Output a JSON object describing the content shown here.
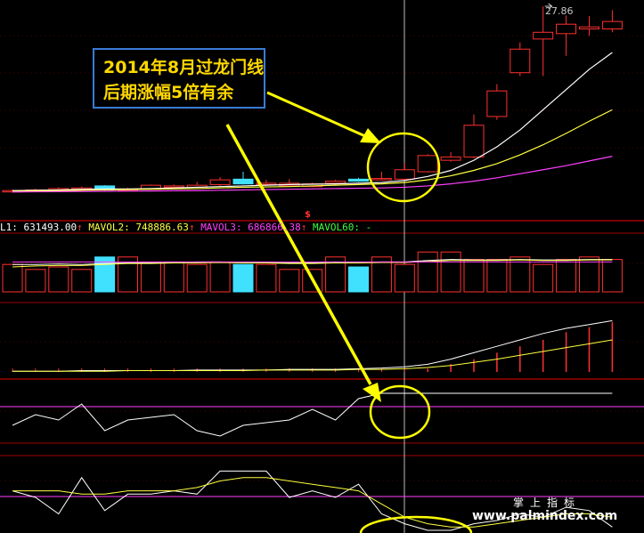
{
  "annotation": {
    "line1": "2014年8月过龙门线",
    "line2": "后期涨幅5倍有余"
  },
  "price_label": "27.86",
  "signal_mark": "$",
  "volume_legend": {
    "item1": "L1: 631493.00",
    "item2": "MAVOL2: 748886.63",
    "item3": "MAVOL3: 686866.38",
    "item4": "MAVOL60: -"
  },
  "watermark": {
    "cn": "掌上指标",
    "url": "www.palmindex.com"
  },
  "colors": {
    "background": "#000000",
    "up": "#ff3030",
    "down": "#40e0ff",
    "ma_white": "#ffffff",
    "ma_yellow": "#ffff40",
    "ma_magenta": "#ff40ff",
    "annotation_border": "#3a7bd5",
    "highlight": "#ffff00",
    "grid": "#a00000"
  },
  "chart_data": [
    {
      "type": "candlestick",
      "title": "",
      "candles": [
        {
          "o": 0.3,
          "c": 0.5,
          "h": 0.7,
          "l": 0.2
        },
        {
          "o": 0.4,
          "c": 0.6,
          "h": 0.8,
          "l": 0.3
        },
        {
          "o": 0.5,
          "c": 0.8,
          "h": 1.0,
          "l": 0.4
        },
        {
          "o": 0.8,
          "c": 0.9,
          "h": 1.1,
          "l": 0.7
        },
        {
          "o": 1.2,
          "c": 0.6,
          "h": 1.3,
          "l": 0.5
        },
        {
          "o": 0.6,
          "c": 0.7,
          "h": 0.9,
          "l": 0.5
        },
        {
          "o": 0.7,
          "c": 1.3,
          "h": 1.4,
          "l": 0.6
        },
        {
          "o": 1.0,
          "c": 1.2,
          "h": 1.4,
          "l": 0.9
        },
        {
          "o": 1.0,
          "c": 1.3,
          "h": 1.8,
          "l": 0.9
        },
        {
          "o": 1.4,
          "c": 2.1,
          "h": 2.5,
          "l": 1.2
        },
        {
          "o": 2.2,
          "c": 1.5,
          "h": 3.3,
          "l": 1.4
        },
        {
          "o": 1.5,
          "c": 1.6,
          "h": 2.1,
          "l": 1.3
        },
        {
          "o": 1.2,
          "c": 1.6,
          "h": 2.2,
          "l": 1.1
        },
        {
          "o": 1.1,
          "c": 1.5,
          "h": 1.7,
          "l": 1.0
        },
        {
          "o": 1.6,
          "c": 1.9,
          "h": 2.1,
          "l": 1.4
        },
        {
          "o": 2.2,
          "c": 1.9,
          "h": 2.4,
          "l": 1.8
        },
        {
          "o": 2.2,
          "c": 2.3,
          "h": 3.3,
          "l": 2.0
        },
        {
          "o": 2.2,
          "c": 3.6,
          "h": 4.6,
          "l": 2.0
        },
        {
          "o": 3.3,
          "c": 5.7,
          "h": 5.9,
          "l": 3.2
        },
        {
          "o": 5.0,
          "c": 5.5,
          "h": 6.2,
          "l": 4.8
        },
        {
          "o": 5.5,
          "c": 10.2,
          "h": 11.8,
          "l": 5.3
        },
        {
          "o": 11.5,
          "c": 15.3,
          "h": 16.3,
          "l": 11.0
        },
        {
          "o": 18.0,
          "c": 21.5,
          "h": 22.5,
          "l": 17.5
        },
        {
          "o": 23.0,
          "c": 24.0,
          "h": 27.86,
          "l": 17.5
        },
        {
          "o": 23.8,
          "c": 25.2,
          "h": 26.5,
          "l": 20.5
        },
        {
          "o": 24.5,
          "c": 24.8,
          "h": 26.4,
          "l": 23.5
        },
        {
          "o": 24.5,
          "c": 25.6,
          "h": 27.3,
          "l": 24.0
        }
      ],
      "down_candles": [
        4,
        10,
        15
      ],
      "series": [
        {
          "name": "",
          "color": "white",
          "values": [
            0.5,
            0.55,
            0.6,
            0.7,
            0.75,
            0.75,
            0.8,
            0.9,
            1.0,
            1.1,
            1.2,
            1.3,
            1.4,
            1.45,
            1.5,
            1.6,
            1.7,
            2.0,
            2.6,
            3.5,
            5.0,
            7.0,
            9.5,
            12.5,
            15.5,
            18.5,
            21.0
          ]
        },
        {
          "name": "",
          "color": "yellow",
          "values": [
            0.4,
            0.45,
            0.5,
            0.55,
            0.6,
            0.65,
            0.7,
            0.75,
            0.8,
            0.9,
            1.0,
            1.05,
            1.1,
            1.2,
            1.3,
            1.4,
            1.5,
            1.7,
            2.1,
            2.7,
            3.5,
            4.5,
            5.8,
            7.3,
            9.0,
            10.8,
            12.5
          ]
        },
        {
          "name": "",
          "color": "magenta",
          "values": [
            0.3,
            0.32,
            0.35,
            0.38,
            0.4,
            0.42,
            0.45,
            0.48,
            0.5,
            0.55,
            0.6,
            0.65,
            0.7,
            0.75,
            0.8,
            0.85,
            0.9,
            1.0,
            1.2,
            1.5,
            1.9,
            2.4,
            3.0,
            3.6,
            4.2,
            4.9,
            5.6
          ]
        }
      ],
      "ylim": [
        0,
        28
      ]
    },
    {
      "type": "bar",
      "title": "",
      "values": [
        0.55,
        0.45,
        0.5,
        0.45,
        0.7,
        0.7,
        0.6,
        0.6,
        0.55,
        0.6,
        0.55,
        0.55,
        0.45,
        0.45,
        0.7,
        0.5,
        0.7,
        0.55,
        0.8,
        0.8,
        0.65,
        0.65,
        0.7,
        0.55,
        0.65,
        0.7,
        0.65
      ],
      "down_bars": [
        4,
        10,
        15
      ],
      "series": [
        {
          "name": "L1",
          "color": "white",
          "values": [
            0.55,
            0.55,
            0.56,
            0.55,
            0.57,
            0.58,
            0.58,
            0.59,
            0.6,
            0.6,
            0.59,
            0.59,
            0.58,
            0.58,
            0.6,
            0.59,
            0.6,
            0.6,
            0.63,
            0.65,
            0.64,
            0.64,
            0.65,
            0.64,
            0.64,
            0.65,
            0.65
          ]
        },
        {
          "name": "MAVOL2",
          "color": "yellow",
          "values": [
            0.5,
            0.52,
            0.53,
            0.53,
            0.55,
            0.57,
            0.57,
            0.58,
            0.58,
            0.59,
            0.58,
            0.58,
            0.57,
            0.57,
            0.58,
            0.58,
            0.59,
            0.59,
            0.61,
            0.63,
            0.63,
            0.63,
            0.64,
            0.63,
            0.63,
            0.64,
            0.64
          ]
        },
        {
          "name": "MAVOL3",
          "color": "magenta",
          "values": [
            0.6,
            0.6,
            0.6,
            0.6,
            0.6,
            0.6,
            0.6,
            0.6,
            0.6,
            0.6,
            0.6,
            0.6,
            0.6,
            0.6,
            0.6,
            0.6,
            0.6,
            0.6,
            0.6,
            0.6,
            0.6,
            0.6,
            0.6,
            0.6,
            0.6,
            0.6,
            0.6
          ]
        }
      ],
      "ylim": [
        0,
        1
      ]
    },
    {
      "type": "line",
      "title": "",
      "bars": [
        0,
        0,
        0,
        0,
        0,
        0,
        0,
        0,
        0,
        0,
        0,
        0,
        0,
        0,
        0,
        0,
        0,
        0,
        0.05,
        0.12,
        0.2,
        0.3,
        0.4,
        0.5,
        0.62,
        0.7,
        0.78
      ],
      "series": [
        {
          "name": "",
          "color": "white",
          "values": [
            0.01,
            0.01,
            0.01,
            0.02,
            0.02,
            0.02,
            0.02,
            0.02,
            0.03,
            0.03,
            0.03,
            0.03,
            0.04,
            0.04,
            0.04,
            0.05,
            0.06,
            0.08,
            0.12,
            0.2,
            0.3,
            0.4,
            0.5,
            0.6,
            0.68,
            0.74,
            0.8
          ]
        },
        {
          "name": "",
          "color": "yellow",
          "values": [
            0.01,
            0.01,
            0.01,
            0.01,
            0.01,
            0.02,
            0.02,
            0.02,
            0.02,
            0.02,
            0.02,
            0.03,
            0.03,
            0.03,
            0.03,
            0.04,
            0.04,
            0.05,
            0.07,
            0.1,
            0.15,
            0.2,
            0.26,
            0.32,
            0.38,
            0.44,
            0.5
          ]
        }
      ],
      "ylim": [
        0,
        1
      ]
    },
    {
      "type": "line",
      "title": "",
      "series": [
        {
          "name": "",
          "color": "white",
          "values": [
            0.3,
            0.5,
            0.4,
            0.7,
            0.2,
            0.4,
            0.45,
            0.5,
            0.2,
            0.1,
            0.3,
            0.35,
            0.4,
            0.6,
            0.4,
            0.8,
            0.9,
            0.9,
            0.9,
            0.9,
            0.9,
            0.9,
            0.9,
            0.9,
            0.9,
            0.9,
            0.9
          ]
        }
      ],
      "reference_line": 0.65,
      "ylim": [
        0,
        1
      ]
    },
    {
      "type": "line",
      "title": "",
      "series": [
        {
          "name": "",
          "color": "white",
          "values": [
            0.6,
            0.5,
            0.25,
            0.8,
            0.3,
            0.55,
            0.55,
            0.6,
            0.55,
            0.9,
            0.9,
            0.9,
            0.5,
            0.6,
            0.5,
            0.7,
            0.25,
            0.1,
            0.0,
            0.0,
            0.1,
            0.15,
            0.25,
            0.2,
            0.35,
            0.3,
            0.05
          ]
        },
        {
          "name": "",
          "color": "yellow",
          "values": [
            0.6,
            0.6,
            0.6,
            0.55,
            0.55,
            0.6,
            0.6,
            0.6,
            0.65,
            0.75,
            0.8,
            0.8,
            0.75,
            0.7,
            0.65,
            0.6,
            0.4,
            0.2,
            0.1,
            0.05,
            0.05,
            0.1,
            0.15,
            0.2,
            0.25,
            0.25,
            0.2
          ]
        }
      ],
      "ylim": [
        0,
        1
      ]
    }
  ]
}
